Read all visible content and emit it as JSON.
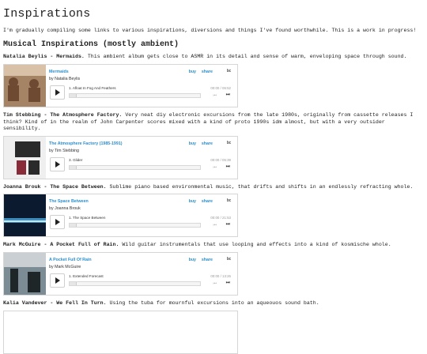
{
  "title": "Inspirations",
  "intro": "I'm gradually compiling some links to various inspirations, diversions and things I've found worthwhile. This is a work in progress!",
  "section_heading": "Musical Inspirations (mostly ambient)",
  "entries": [
    {
      "artist_title": "Natalia Beylis - Mermaids.",
      "description": " This ambient album gets close to ASMR in its detail and sense of warm, enveloping space through sound.",
      "album": "Mermaids",
      "by": "by Natalia Beylis",
      "buy": "buy",
      "share": "share",
      "logo": "bc",
      "track": "1.   Afloat In Fog And Feathers",
      "time": "00:00 / 06:52",
      "colors": [
        "#a58466",
        "#d8c1a6",
        "#6e4a33"
      ]
    },
    {
      "artist_title": "Tim Stebbing - The Atmosphere Factory.",
      "description": " Very neat diy electronic excursions from the late 1980s, originally from cassette releases I think? Kind of in the realm of John Carpenter scores mixed with a kind of proto 1990s idm almost, but with a very outsider sensibility.",
      "album": "The Atmosphere Factory (1985-1991)",
      "by": "by Tim Stebbing",
      "buy": "buy",
      "share": "share",
      "logo": "bc",
      "track": "3.   Glider",
      "time": "00:00 / 05:39",
      "colors": [
        "#efefef",
        "#8a2b3a",
        "#2a2a2a"
      ]
    },
    {
      "artist_title": "Joanna Brouk - The Space Between.",
      "description": " Sublime piano based environmental music, that drifts and shifts in an endlessly refracting whole.",
      "album": "The Space Between",
      "by": "by Joanna Brouk",
      "buy": "buy",
      "share": "share",
      "logo": "bc",
      "track": "1.   The Space Between",
      "time": "00:00 / 21:53",
      "colors": [
        "#0b1a2e",
        "#3b8fc0",
        "#cfe6f2"
      ]
    },
    {
      "artist_title": "Mark McGuire - A Pocket Full of Rain.",
      "description": " Wild guitar instrumentals that use looping and effects into a kind of kosmische whole.",
      "album": "A Pocket Full Of Rain",
      "by": "by Mark McGuire",
      "buy": "buy",
      "share": "share",
      "logo": "bc",
      "track": "1.   Extended Forecast",
      "time": "00:00 / 13:26",
      "colors": [
        "#7c8c94",
        "#1f2628",
        "#c9cfd2"
      ]
    }
  ],
  "last_entry": {
    "artist_title": "Kalia Vandever - We Fell In Turn.",
    "description": " Using the tuba for mournful excursions into an aqueouos sound bath."
  }
}
